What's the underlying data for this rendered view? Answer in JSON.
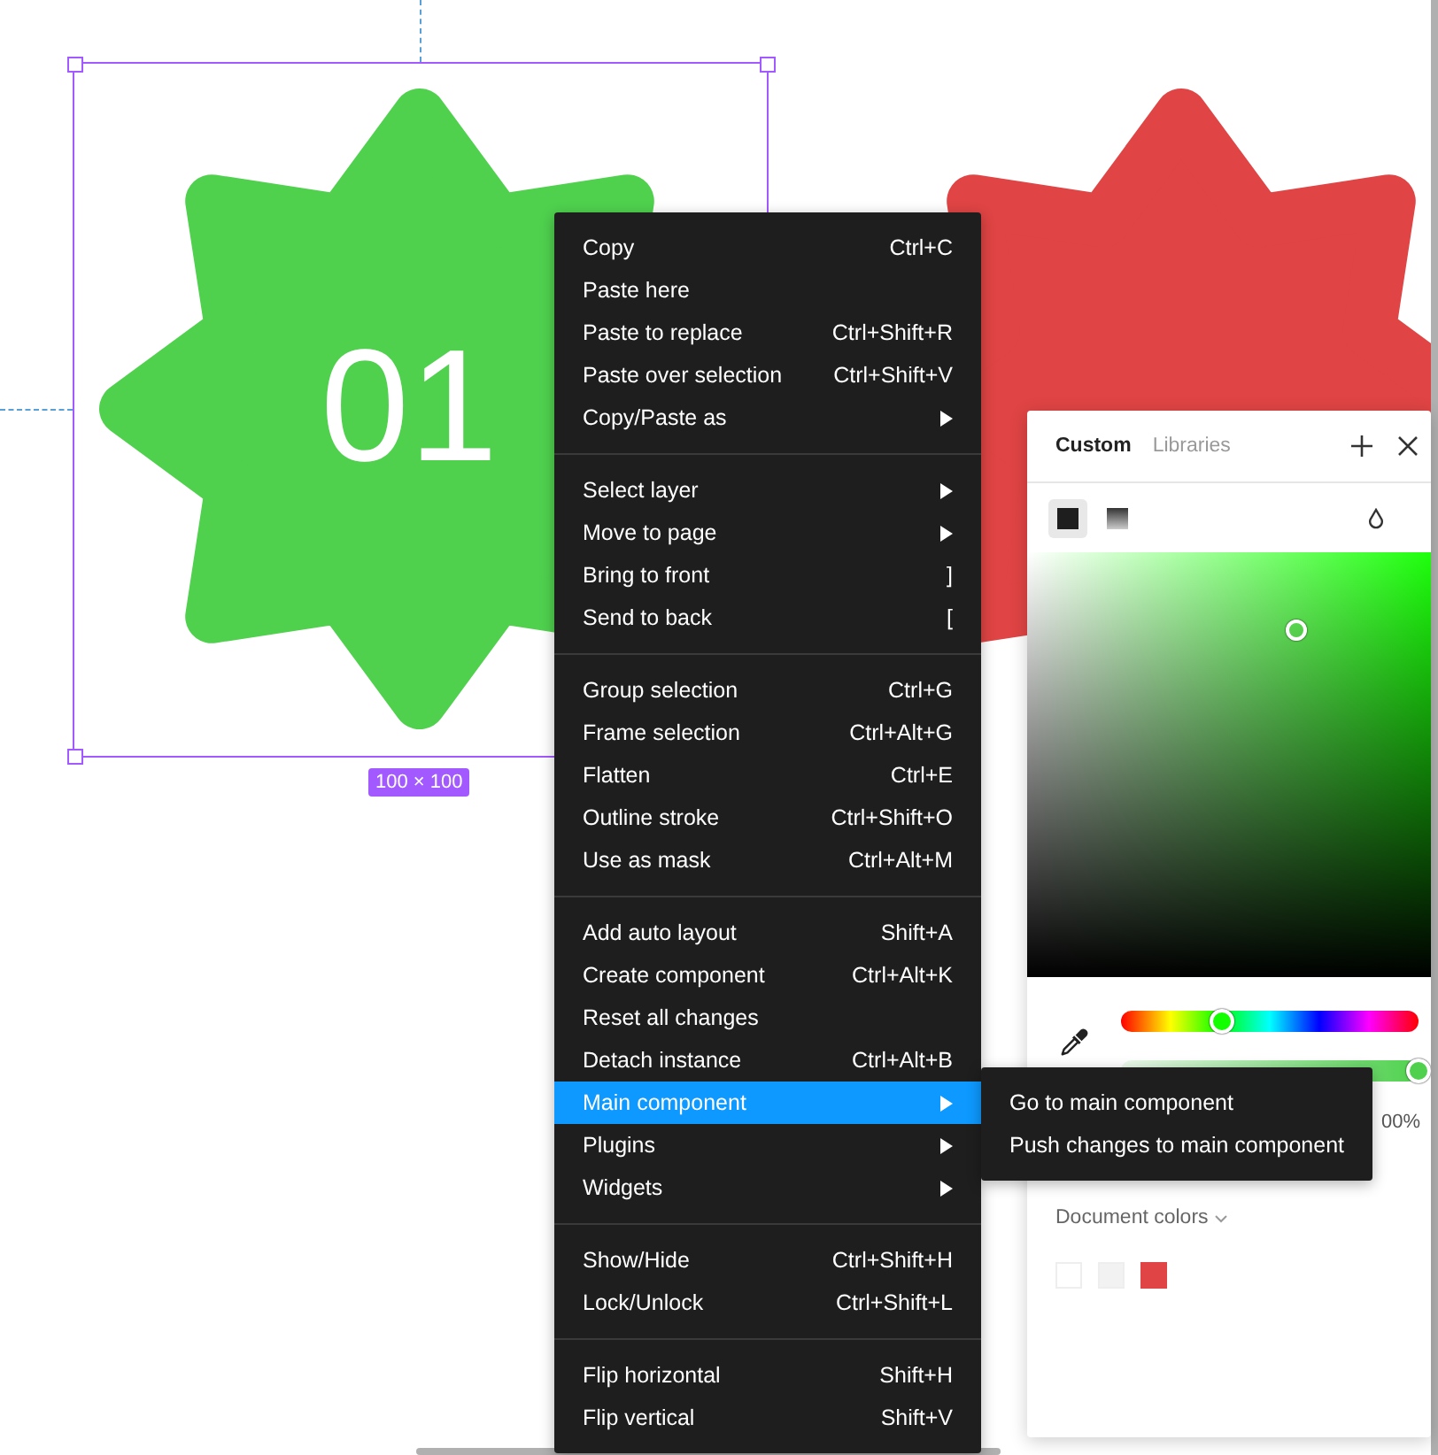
{
  "canvas": {
    "shapes": [
      {
        "label": "01",
        "color": "#4fd14e",
        "selected": true
      },
      {
        "color": "#e04444",
        "selected": false
      }
    ],
    "size_label": "100 × 100"
  },
  "context_menu": {
    "sections": [
      [
        {
          "label": "Copy",
          "shortcut": "Ctrl+C",
          "kind": "command",
          "selected": false
        },
        {
          "label": "Paste here",
          "kind": "command",
          "selected": false
        },
        {
          "label": "Paste to replace",
          "shortcut": "Ctrl+Shift+R",
          "kind": "command",
          "selected": false
        },
        {
          "label": "Paste over selection",
          "shortcut": "Ctrl+Shift+V",
          "kind": "command",
          "selected": false
        },
        {
          "label": "Copy/Paste as",
          "kind": "submenu",
          "selected": false
        }
      ],
      [
        {
          "label": "Select layer",
          "kind": "submenu",
          "selected": false
        },
        {
          "label": "Move to page",
          "kind": "submenu",
          "selected": false
        },
        {
          "label": "Bring to front",
          "shortcut": "]",
          "kind": "command",
          "selected": false
        },
        {
          "label": "Send to back",
          "shortcut": "[",
          "kind": "command",
          "selected": false
        }
      ],
      [
        {
          "label": "Group selection",
          "shortcut": "Ctrl+G",
          "kind": "command",
          "selected": false
        },
        {
          "label": "Frame selection",
          "shortcut": "Ctrl+Alt+G",
          "kind": "command",
          "selected": false
        },
        {
          "label": "Flatten",
          "shortcut": "Ctrl+E",
          "kind": "command",
          "selected": false
        },
        {
          "label": "Outline stroke",
          "shortcut": "Ctrl+Shift+O",
          "kind": "command",
          "selected": false
        },
        {
          "label": "Use as mask",
          "shortcut": "Ctrl+Alt+M",
          "kind": "command",
          "selected": false
        }
      ],
      [
        {
          "label": "Add auto layout",
          "shortcut": "Shift+A",
          "kind": "command",
          "selected": false
        },
        {
          "label": "Create component",
          "shortcut": "Ctrl+Alt+K",
          "kind": "command",
          "selected": false
        },
        {
          "label": "Reset all changes",
          "kind": "command",
          "selected": false
        },
        {
          "label": "Detach instance",
          "shortcut": "Ctrl+Alt+B",
          "kind": "command",
          "selected": false
        },
        {
          "label": "Main component",
          "kind": "submenu",
          "selected": true
        },
        {
          "label": "Plugins",
          "kind": "submenu",
          "selected": false
        },
        {
          "label": "Widgets",
          "kind": "submenu",
          "selected": false
        }
      ],
      [
        {
          "label": "Show/Hide",
          "shortcut": "Ctrl+Shift+H",
          "kind": "command",
          "selected": false
        },
        {
          "label": "Lock/Unlock",
          "shortcut": "Ctrl+Shift+L",
          "kind": "command",
          "selected": false
        }
      ],
      [
        {
          "label": "Flip horizontal",
          "shortcut": "Shift+H",
          "kind": "command",
          "selected": false
        },
        {
          "label": "Flip vertical",
          "shortcut": "Shift+V",
          "kind": "command",
          "selected": false
        }
      ]
    ],
    "submenu": [
      "Go to main component",
      "Push changes to main component"
    ]
  },
  "color_panel": {
    "tabs": [
      {
        "label": "Custom",
        "selected": true
      },
      {
        "label": "Libraries",
        "selected": false
      }
    ],
    "fill_types": [
      {
        "kind": "solid",
        "selected": true
      },
      {
        "kind": "gradient",
        "selected": false
      }
    ],
    "hue": {
      "level": 0.34
    },
    "opacity": {
      "level": 1,
      "reading": "00%"
    },
    "document_colors": {
      "label": "Document colors",
      "swatches": [
        {
          "color": "#ffffff"
        },
        {
          "color": "#f2f2f2"
        },
        {
          "color": "#e04444"
        }
      ]
    }
  }
}
